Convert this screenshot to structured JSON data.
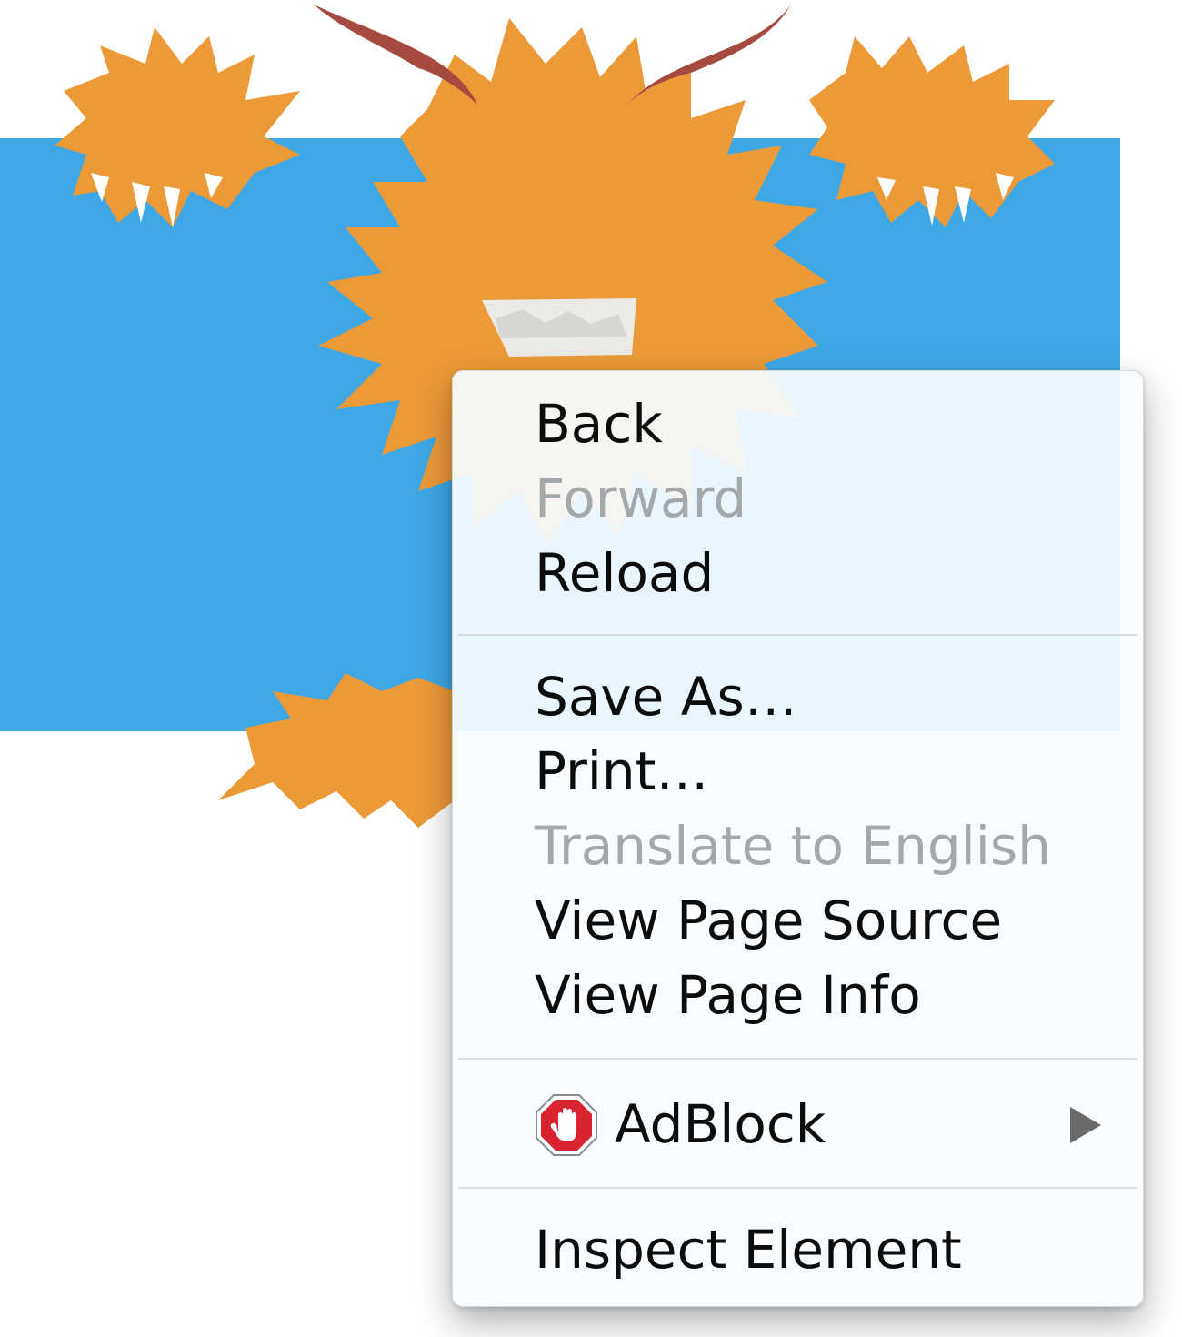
{
  "page": {
    "banner_color": "#3ea8e6",
    "monster_color": "#ec9a38",
    "horn_color": "#a54a3e"
  },
  "context_menu": {
    "sections": [
      {
        "items": [
          {
            "label": "Back",
            "enabled": true
          },
          {
            "label": "Forward",
            "enabled": false
          },
          {
            "label": "Reload",
            "enabled": true
          }
        ]
      },
      {
        "items": [
          {
            "label": "Save As…",
            "enabled": true
          },
          {
            "label": "Print…",
            "enabled": true
          },
          {
            "label": "Translate to English",
            "enabled": false
          },
          {
            "label": "View Page Source",
            "enabled": true
          },
          {
            "label": "View Page Info",
            "enabled": true
          }
        ]
      },
      {
        "items": [
          {
            "label": "AdBlock",
            "enabled": true,
            "icon": "adblock-stop-hand-icon",
            "has_submenu": true
          }
        ]
      },
      {
        "items": [
          {
            "label": "Inspect Element",
            "enabled": true
          }
        ]
      }
    ],
    "colors": {
      "text": "#0c0c0c",
      "disabled_text": "#a5a8ab",
      "adblock_red": "#d9232e"
    }
  }
}
